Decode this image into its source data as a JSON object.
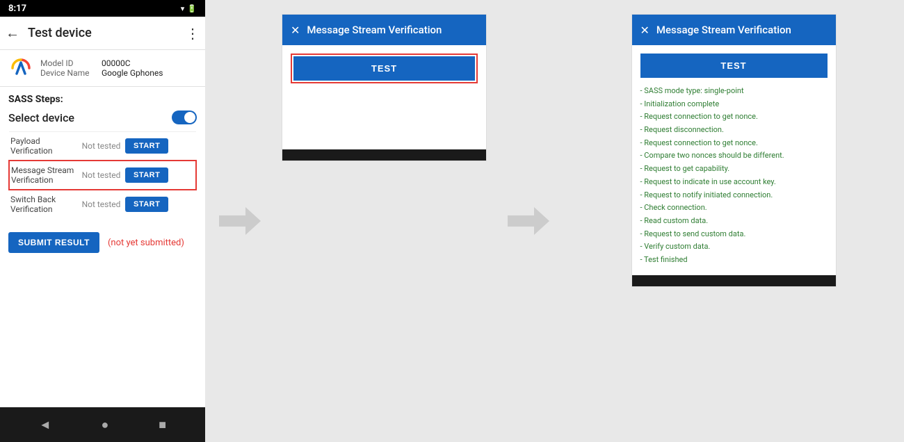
{
  "statusBar": {
    "time": "8:17",
    "icons": "▣ ☆ ⚙ ☁ •",
    "rightIcons": "▾ 🔋"
  },
  "phone": {
    "backIcon": "←",
    "title": "Test device",
    "moreIcon": "⋮",
    "device": {
      "modelLabel": "Model ID",
      "modelValue": "00000C",
      "nameLabel": "Device Name",
      "nameValue": "Google Gphones"
    },
    "sassTitle": "SASS Steps:",
    "selectDeviceLabel": "Select device",
    "steps": [
      {
        "name": "Payload Verification",
        "status": "Not tested",
        "btnLabel": "START",
        "highlighted": false
      },
      {
        "name": "Message Stream Verification",
        "status": "Not tested",
        "btnLabel": "START",
        "highlighted": true
      },
      {
        "name": "Switch Back Verification",
        "status": "Not tested",
        "btnLabel": "START",
        "highlighted": false
      }
    ],
    "submitBtn": "SUBMIT RESULT",
    "notSubmitted": "(not yet submitted)",
    "navBack": "◄",
    "navHome": "●",
    "navRecent": "■"
  },
  "dialog1": {
    "closeIcon": "✕",
    "title": "Message Stream Verification",
    "testBtn": "TEST",
    "hasResults": false
  },
  "dialog2": {
    "closeIcon": "✕",
    "title": "Message Stream Verification",
    "testBtn": "TEST",
    "hasResults": true,
    "results": [
      "- SASS mode type: single-point",
      "- Initialization complete",
      "- Request connection to get nonce.",
      "- Request disconnection.",
      "- Request connection to get nonce.",
      "- Compare two nonces should be different.",
      "- Request to get capability.",
      "- Request to indicate in use account key.",
      "- Request to notify initiated connection.",
      "- Check connection.",
      "- Read custom data.",
      "- Request to send custom data.",
      "- Verify custom data.",
      "- Test finished"
    ]
  }
}
